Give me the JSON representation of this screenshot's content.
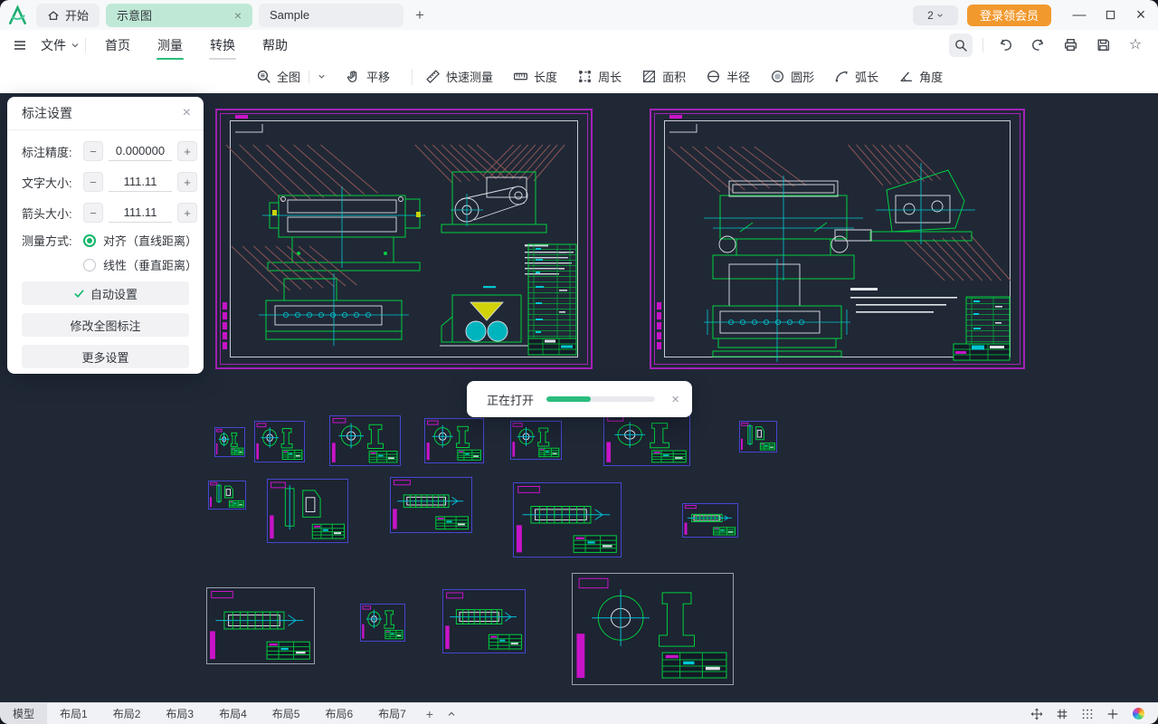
{
  "titlebar": {
    "home_tab": "开始",
    "tabs": [
      {
        "label": "示意图",
        "active": true
      },
      {
        "label": "Sample",
        "active": false
      }
    ],
    "account_badge": "2",
    "login_button": "登录领会员"
  },
  "menubar": {
    "file": "文件",
    "items": [
      {
        "label": "首页",
        "active": false
      },
      {
        "label": "测量",
        "active": true
      },
      {
        "label": "转换",
        "active": false
      },
      {
        "label": "帮助",
        "active": false
      }
    ]
  },
  "toolbar": {
    "tools": [
      {
        "label": "全图",
        "icon": "fit-view-icon",
        "has_dropdown": true
      },
      {
        "label": "平移",
        "icon": "pan-hand-icon"
      },
      {
        "label": "快速测量",
        "icon": "quick-measure-icon"
      },
      {
        "label": "长度",
        "icon": "length-icon"
      },
      {
        "label": "周长",
        "icon": "perimeter-icon"
      },
      {
        "label": "面积",
        "icon": "area-icon"
      },
      {
        "label": "半径",
        "icon": "radius-icon"
      },
      {
        "label": "圆形",
        "icon": "circle-icon"
      },
      {
        "label": "弧长",
        "icon": "arc-length-icon"
      },
      {
        "label": "角度",
        "icon": "angle-icon"
      }
    ]
  },
  "panel": {
    "title": "标注设置",
    "fields": [
      {
        "label": "标注精度:",
        "value": "0.000000"
      },
      {
        "label": "文字大小:",
        "value": "111.11"
      },
      {
        "label": "箭头大小:",
        "value": "111.11"
      }
    ],
    "measure_mode_label": "测量方式:",
    "radios": [
      {
        "label": "对齐（直线距离）",
        "selected": true
      },
      {
        "label": "线性（垂直距离）",
        "selected": false
      }
    ],
    "auto_button": "自动设置",
    "modify_button": "修改全图标注",
    "more_button": "更多设置"
  },
  "progress_dialog": {
    "label": "正在打开",
    "percent": 41
  },
  "bottombar": {
    "tabs": [
      {
        "label": "模型",
        "active": true
      },
      {
        "label": "布局1",
        "active": false
      },
      {
        "label": "布局2",
        "active": false
      },
      {
        "label": "布局3",
        "active": false
      },
      {
        "label": "布局4",
        "active": false
      },
      {
        "label": "布局5",
        "active": false
      },
      {
        "label": "布局6",
        "active": false
      },
      {
        "label": "布局7",
        "active": false
      }
    ]
  },
  "icons": {
    "close": "×",
    "minimize": "—",
    "minus": "−",
    "plus": "+",
    "star": "☆"
  },
  "colors": {
    "accent_green": "#2bbd7e",
    "active_tab_mint": "#bfe9d6",
    "login_orange": "#f2992e",
    "canvas_bg": "#202836",
    "frame_magenta": "#a422b8",
    "thumb_border_blue": "#4646d0",
    "drawing_green": "#00cf3f",
    "drawing_cyan": "#00c8d2",
    "leader_brown": "#8a5454"
  }
}
